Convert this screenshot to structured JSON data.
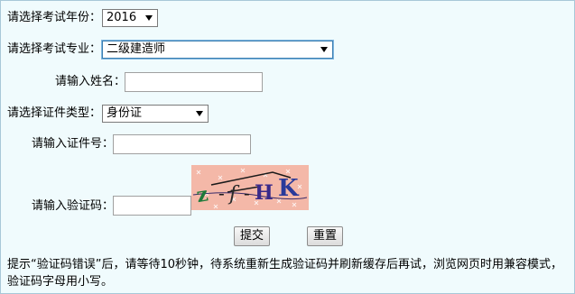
{
  "form": {
    "year": {
      "label": "请选择考试年份：",
      "value": "2016"
    },
    "major": {
      "label": "请选择考试专业：",
      "value": "二级建造师"
    },
    "name": {
      "label": "请输入姓名：",
      "value": ""
    },
    "id_type": {
      "label": "请选择证件类型：",
      "value": "身份证"
    },
    "id_number": {
      "label": "请输入证件号：",
      "value": ""
    },
    "captcha": {
      "label": "请输入验证码：",
      "value": "",
      "image_text": "z f H K"
    },
    "submit_label": "提交",
    "reset_label": "重置"
  },
  "notice": "提示“验证码错误”后，请等待10秒钟，待系统重新生成验证码并刷新缓存后再试，浏览网页时用兼容模式，验证码字母用小写。",
  "colors": {
    "panel_bg": "#f0fbfd",
    "panel_border": "#a8c8d8",
    "focus_border": "#3c7fb1"
  }
}
